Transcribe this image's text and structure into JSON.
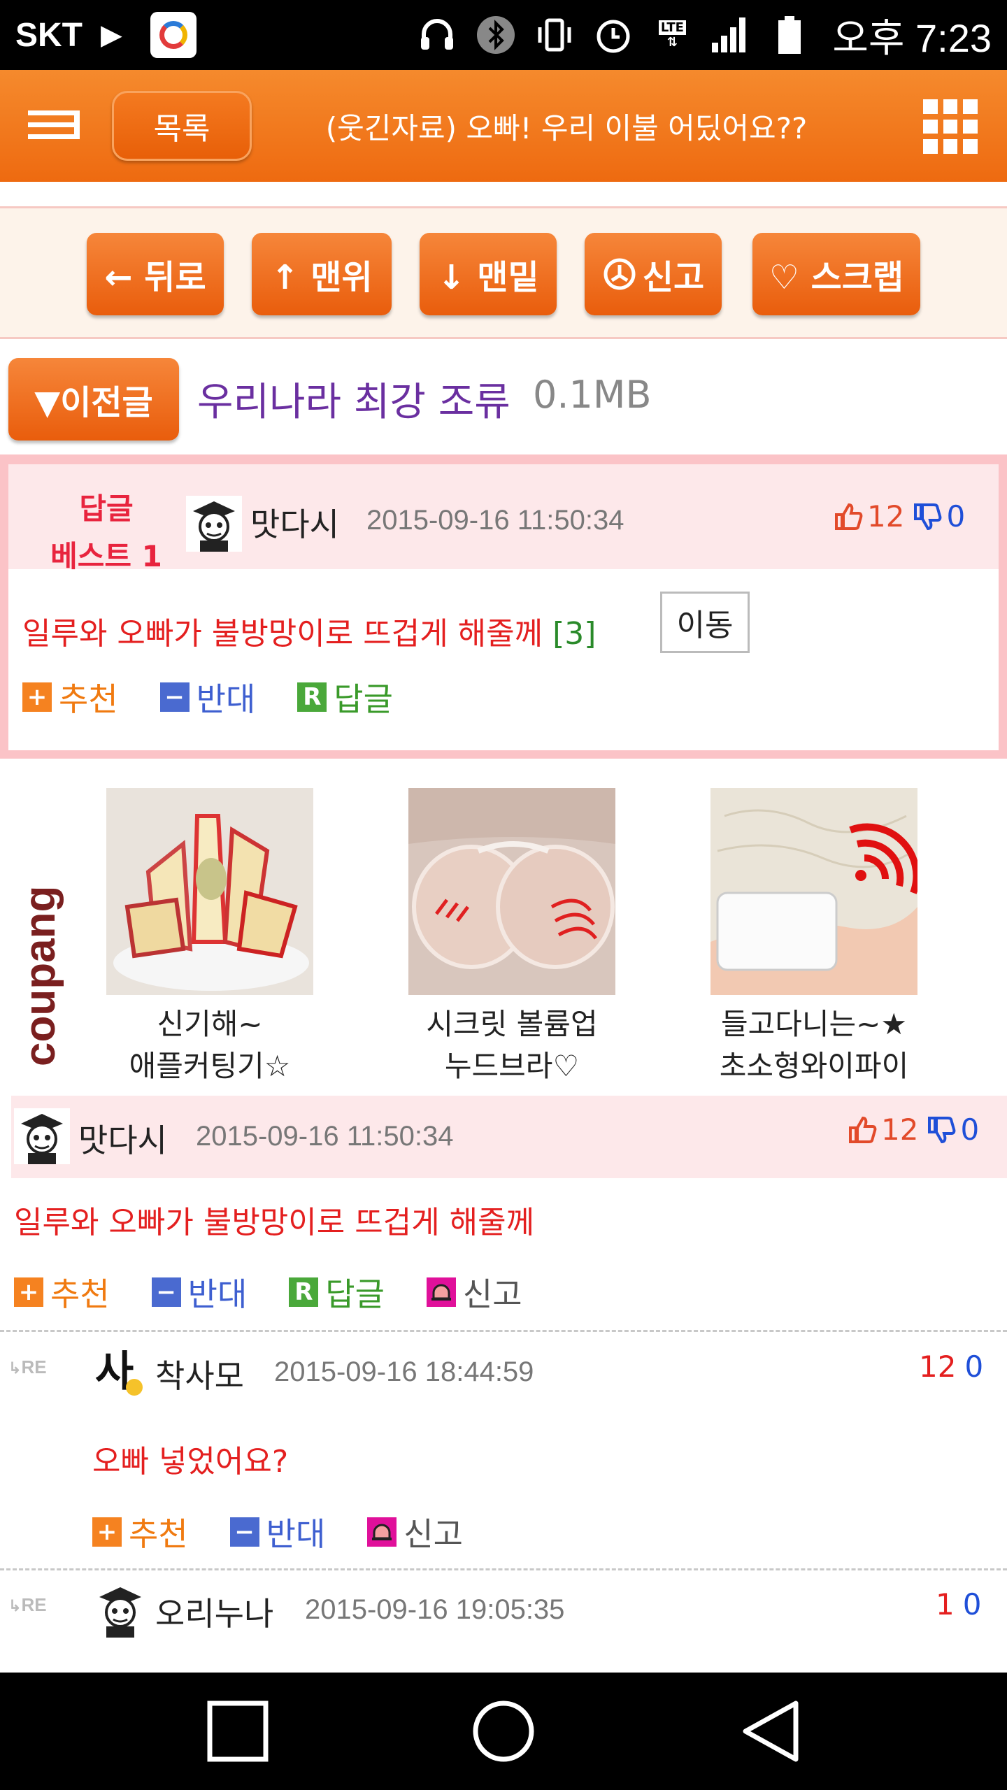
{
  "statusbar": {
    "carrier": "SKT",
    "lte": "LTE",
    "time": "오후 7:23"
  },
  "header": {
    "list_label": "목록",
    "title": "(웃긴자료) 오빠! 우리 이불 어딨어요??"
  },
  "nav": {
    "back": "← 뒤로",
    "top": "↑ 맨위",
    "bottom": "↓ 맨밑",
    "report": "신고",
    "scrap": "♡ 스크랩"
  },
  "prev": {
    "button": "▼이전글",
    "title": "우리나라 최강 조류",
    "size": "0.1MB"
  },
  "best": {
    "label_line1": "답글",
    "label_line2": "베스트 1",
    "user": "맛다시",
    "date": "2015-09-16 11:50:34",
    "up": "12",
    "down": "0",
    "text": "일루와 오빠가 불방망이로 뜨겁게 해줄께",
    "count": "[3]",
    "move": "이동",
    "recommend": "추천",
    "oppose": "반대",
    "reply": "답글"
  },
  "ads": {
    "brand": "coupang",
    "items": [
      {
        "line1": "신기해~",
        "line2": "애플커팅기☆"
      },
      {
        "line1": "시크릿 볼륨업",
        "line2": "누드브라♡"
      },
      {
        "line1": "들고다니는~★",
        "line2": "초소형와이파이"
      }
    ]
  },
  "comments": [
    {
      "user": "맛다시",
      "date": "2015-09-16 11:50:34",
      "up": "12",
      "down": "0",
      "text": "일루와 오빠가 불방망이로 뜨겁게 해줄께",
      "recommend": "추천",
      "oppose": "반대",
      "reply": "답글",
      "report": "신고"
    },
    {
      "re": "RE",
      "user": "착사모",
      "date": "2015-09-16 18:44:59",
      "up": "12",
      "down": "0",
      "text": "오빠 넣었어요?",
      "recommend": "추천",
      "oppose": "반대",
      "report": "신고"
    },
    {
      "re": "RE",
      "user": "오리누나",
      "date": "2015-09-16 19:05:35",
      "up": "1",
      "down": "0"
    }
  ],
  "colors": {
    "accent": "#ee6a10",
    "best_border": "#fbc3c7",
    "head_bg": "#fde8ea"
  }
}
